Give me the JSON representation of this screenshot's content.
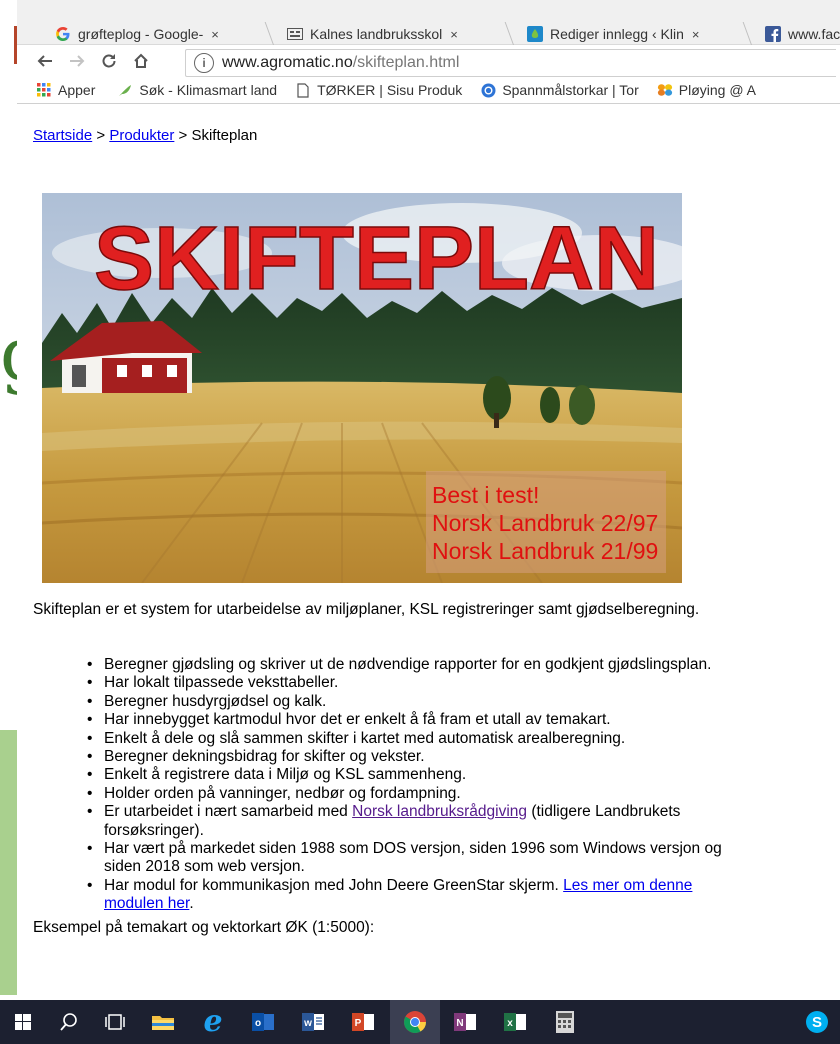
{
  "tabs": [
    {
      "title": "grøfteplog - Google-",
      "icon": "google-icon"
    },
    {
      "title": "Kalnes landbruksskol",
      "icon": "site-icon"
    },
    {
      "title": "Rediger innlegg ‹ Klin",
      "icon": "drop-icon"
    },
    {
      "title": "www.face",
      "icon": "facebook-icon"
    }
  ],
  "tab_close": "×",
  "address": {
    "host": "www.agromatic.no",
    "path": "/skifteplan.html"
  },
  "bookmarks": [
    {
      "label": "Apper",
      "icon": "apps-grid-icon"
    },
    {
      "label": "Søk - Klimasmart land",
      "icon": "leaf-icon"
    },
    {
      "label": "TØRKER | Sisu Produk",
      "icon": "page-icon"
    },
    {
      "label": "Spannmålstorkar | Tor",
      "icon": "blue-circle-icon"
    },
    {
      "label": "Pløying @ A",
      "icon": "flower-icon"
    }
  ],
  "breadcrumb": {
    "home": "Startside",
    "sep1": " > ",
    "products": "Produkter",
    "sep2": " > ",
    "current": "Skifteplan"
  },
  "banner": {
    "title": "SKIFTEPLAN",
    "badge": [
      "Best i test!",
      "Norsk Landbruk 22/97",
      "Norsk Landbruk 21/99"
    ]
  },
  "intro": "Skifteplan er et system for utarbeidelse av miljøplaner, KSL registreringer samt gjødselberegning.",
  "features": [
    "Beregner gjødsling og skriver ut de nødvendige rapporter for en godkjent gjødslingsplan.",
    "Har lokalt tilpassede veksttabeller.",
    "Beregner husdyrgjødsel og kalk.",
    "Har innebygget kartmodul hvor det er enkelt å få fram et utall av temakart.",
    "Enkelt å dele og slå sammen skifter i kartet med automatisk arealberegning.",
    "Beregner dekningsbidrag for skifter og vekster.",
    "Enkelt å registrere data i Miljø og KSL sammenheng.",
    "Holder orden på vanninger, nedbør og fordampning."
  ],
  "feature_nlr": {
    "before": "Er utarbeidet i nært samarbeid med ",
    "link": "Norsk landbruksrådgiving",
    "after": " (tidligere Landbrukets forsøksringer)."
  },
  "feature_history": "Har vært på markedet siden 1988 som DOS versjon, siden 1996 som Windows versjon og siden 2018 som web versjon.",
  "feature_greenstar": {
    "before": "Har modul for kommunikasjon med John Deere GreenStar skjerm. ",
    "link": "Les mer om denne modulen her",
    "after": "."
  },
  "example": "Eksempel på temakart og vektorkart ØK (1:5000):",
  "background_letter": "g",
  "taskbar": [
    "windows-start-icon",
    "search-icon",
    "task-view-icon",
    "file-explorer-icon",
    "internet-explorer-icon",
    "outlook-icon",
    "word-icon",
    "powerpoint-icon",
    "chrome-icon",
    "onenote-icon",
    "excel-icon",
    "calculator-icon",
    "skype-icon"
  ]
}
